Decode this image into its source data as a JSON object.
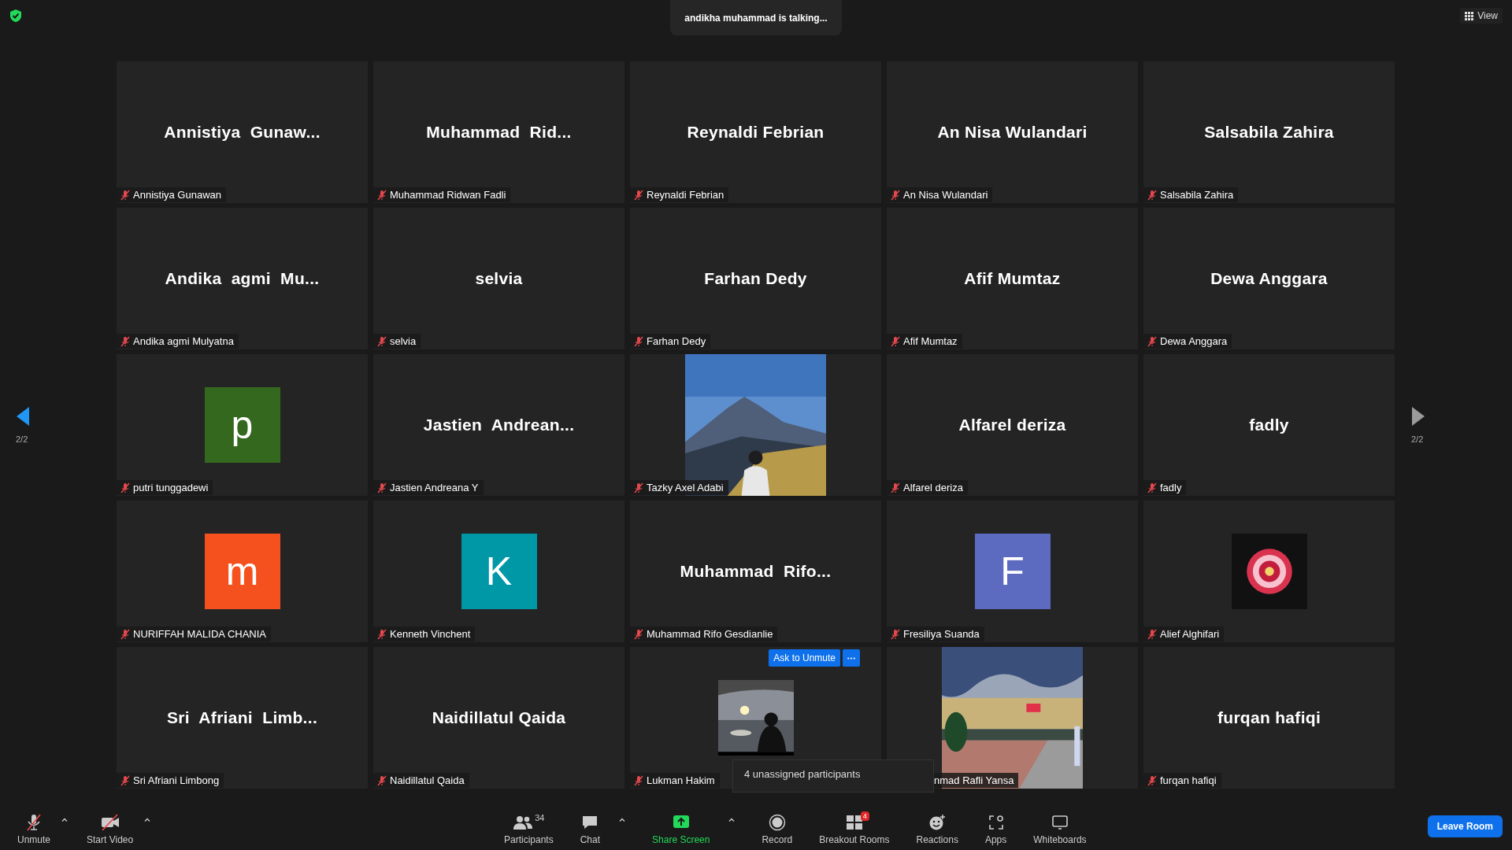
{
  "top_bar": {
    "talking": "andikha muhammad is talking...",
    "view": "View"
  },
  "nav": {
    "prev": {
      "page": "2/2",
      "enabled": true
    },
    "next": {
      "page": "2/2",
      "enabled": false
    }
  },
  "tiles": [
    {
      "kind": "name",
      "display": "Annistiya  Gunaw...",
      "label": "Annistiya Gunawan",
      "muted": true
    },
    {
      "kind": "name",
      "display": "Muhammad  Rid...",
      "label": "Muhammad Ridwan Fadli",
      "muted": true
    },
    {
      "kind": "name",
      "display": "Reynaldi Febrian",
      "label": "Reynaldi Febrian",
      "muted": true
    },
    {
      "kind": "name",
      "display": "An Nisa Wulandari",
      "label": "An Nisa Wulandari",
      "muted": true
    },
    {
      "kind": "name",
      "display": "Salsabila Zahira",
      "label": "Salsabila Zahira",
      "muted": true
    },
    {
      "kind": "name",
      "display": "Andika  agmi  Mu...",
      "label": "Andika agmi Mulyatna",
      "muted": true
    },
    {
      "kind": "name",
      "display": "selvia",
      "label": "selvia",
      "muted": true
    },
    {
      "kind": "name",
      "display": "Farhan Dedy",
      "label": "Farhan Dedy",
      "muted": true
    },
    {
      "kind": "name",
      "display": "Afif Mumtaz",
      "label": "Afif Mumtaz",
      "muted": true
    },
    {
      "kind": "name",
      "display": "Dewa Anggara",
      "label": "Dewa Anggara",
      "muted": true
    },
    {
      "kind": "letter",
      "letter": "p",
      "color": "#34681e",
      "label": "putri tunggadewi",
      "muted": true
    },
    {
      "kind": "name",
      "display": "Jastien  Andrean...",
      "label": "Jastien Andreana Y",
      "muted": true
    },
    {
      "kind": "video",
      "label": "Tazky Axel Adabi",
      "muted": true
    },
    {
      "kind": "name",
      "display": "Alfarel deriza",
      "label": "Alfarel deriza",
      "muted": true
    },
    {
      "kind": "name",
      "display": "fadly",
      "label": "fadly",
      "muted": true
    },
    {
      "kind": "letter",
      "letter": "m",
      "color": "#f4511e",
      "label": "NURIFFAH MALIDA CHANIA",
      "muted": true
    },
    {
      "kind": "letter",
      "letter": "K",
      "color": "#0097a7",
      "label": "Kenneth Vinchent",
      "muted": true
    },
    {
      "kind": "name",
      "display": "Muhammad  Rifo...",
      "label": "Muhammad Rifo Gesdianlie",
      "muted": true
    },
    {
      "kind": "letter",
      "letter": "F",
      "color": "#5c6bc0",
      "label": "Fresiliya Suanda",
      "muted": true
    },
    {
      "kind": "profile",
      "label": "Alief Alghifari",
      "muted": true
    },
    {
      "kind": "name",
      "display": "Sri  Afriani  Limb...",
      "label": "Sri Afriani Limbong",
      "muted": true
    },
    {
      "kind": "name",
      "display": "Naidillatul Qaida",
      "label": "Naidillatul Qaida",
      "muted": true
    },
    {
      "kind": "profile",
      "label": "Lukman Hakim",
      "muted": true,
      "hover": {
        "ask": "Ask to Unmute"
      }
    },
    {
      "kind": "video",
      "label": "nmad Rafli Yansa",
      "covered": true
    },
    {
      "kind": "name",
      "display": "furqan hafiqi",
      "label": "furqan hafiqi",
      "muted": true
    }
  ],
  "popup": {
    "text": "4 unassigned participants"
  },
  "toolbar_left": [
    {
      "label": "Unmute",
      "caret": true
    },
    {
      "label": "Start Video",
      "caret": true
    }
  ],
  "toolbar_center": [
    {
      "label": "Participants",
      "count": "34",
      "caret": false,
      "accent": false
    },
    {
      "label": "Chat",
      "caret": true,
      "accent": false
    },
    {
      "label": "Share Screen",
      "caret": true,
      "accent": true
    },
    {
      "label": "Record",
      "caret": false,
      "accent": false
    },
    {
      "label": "Breakout Rooms",
      "badge": "4",
      "caret": false,
      "accent": false
    },
    {
      "label": "Reactions",
      "caret": false,
      "accent": false
    },
    {
      "label": "Apps",
      "caret": false,
      "accent": false
    },
    {
      "label": "Whiteboards",
      "caret": false,
      "accent": false
    }
  ],
  "leave": "Leave Room"
}
